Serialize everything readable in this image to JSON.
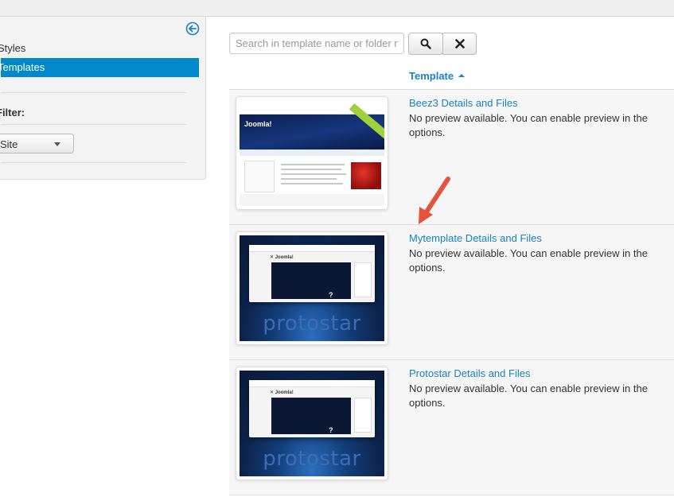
{
  "sidebar": {
    "items": [
      {
        "label": "Styles"
      },
      {
        "label": "Templates"
      }
    ],
    "filter_label": "Filter:",
    "client_select": {
      "value": "Site"
    }
  },
  "search": {
    "placeholder": "Search in template name or folder n",
    "value": ""
  },
  "table": {
    "column_header": "Template",
    "sort": "ascending",
    "rows": [
      {
        "link": "Beez3 Details and Files",
        "description": "No preview available. You can enable preview in the options.",
        "thumbnail": "beez3"
      },
      {
        "link": "Mytemplate Details and Files",
        "description": "No preview available. You can enable preview in the options.",
        "thumbnail": "protostar"
      },
      {
        "link": "Protostar Details and Files",
        "description": "No preview available. You can enable preview in the options.",
        "thumbnail": "protostar"
      }
    ]
  },
  "thumbs": {
    "beez3_title": "Joomla!",
    "protostar_word": "protostar"
  },
  "icons": {
    "collapse": "arrow-left-circle-icon",
    "search": "search-icon",
    "clear": "close-icon"
  },
  "colors": {
    "accent": "#1a82c4",
    "active_bg": "#0088cc",
    "annotation_arrow": "#e5533e"
  }
}
